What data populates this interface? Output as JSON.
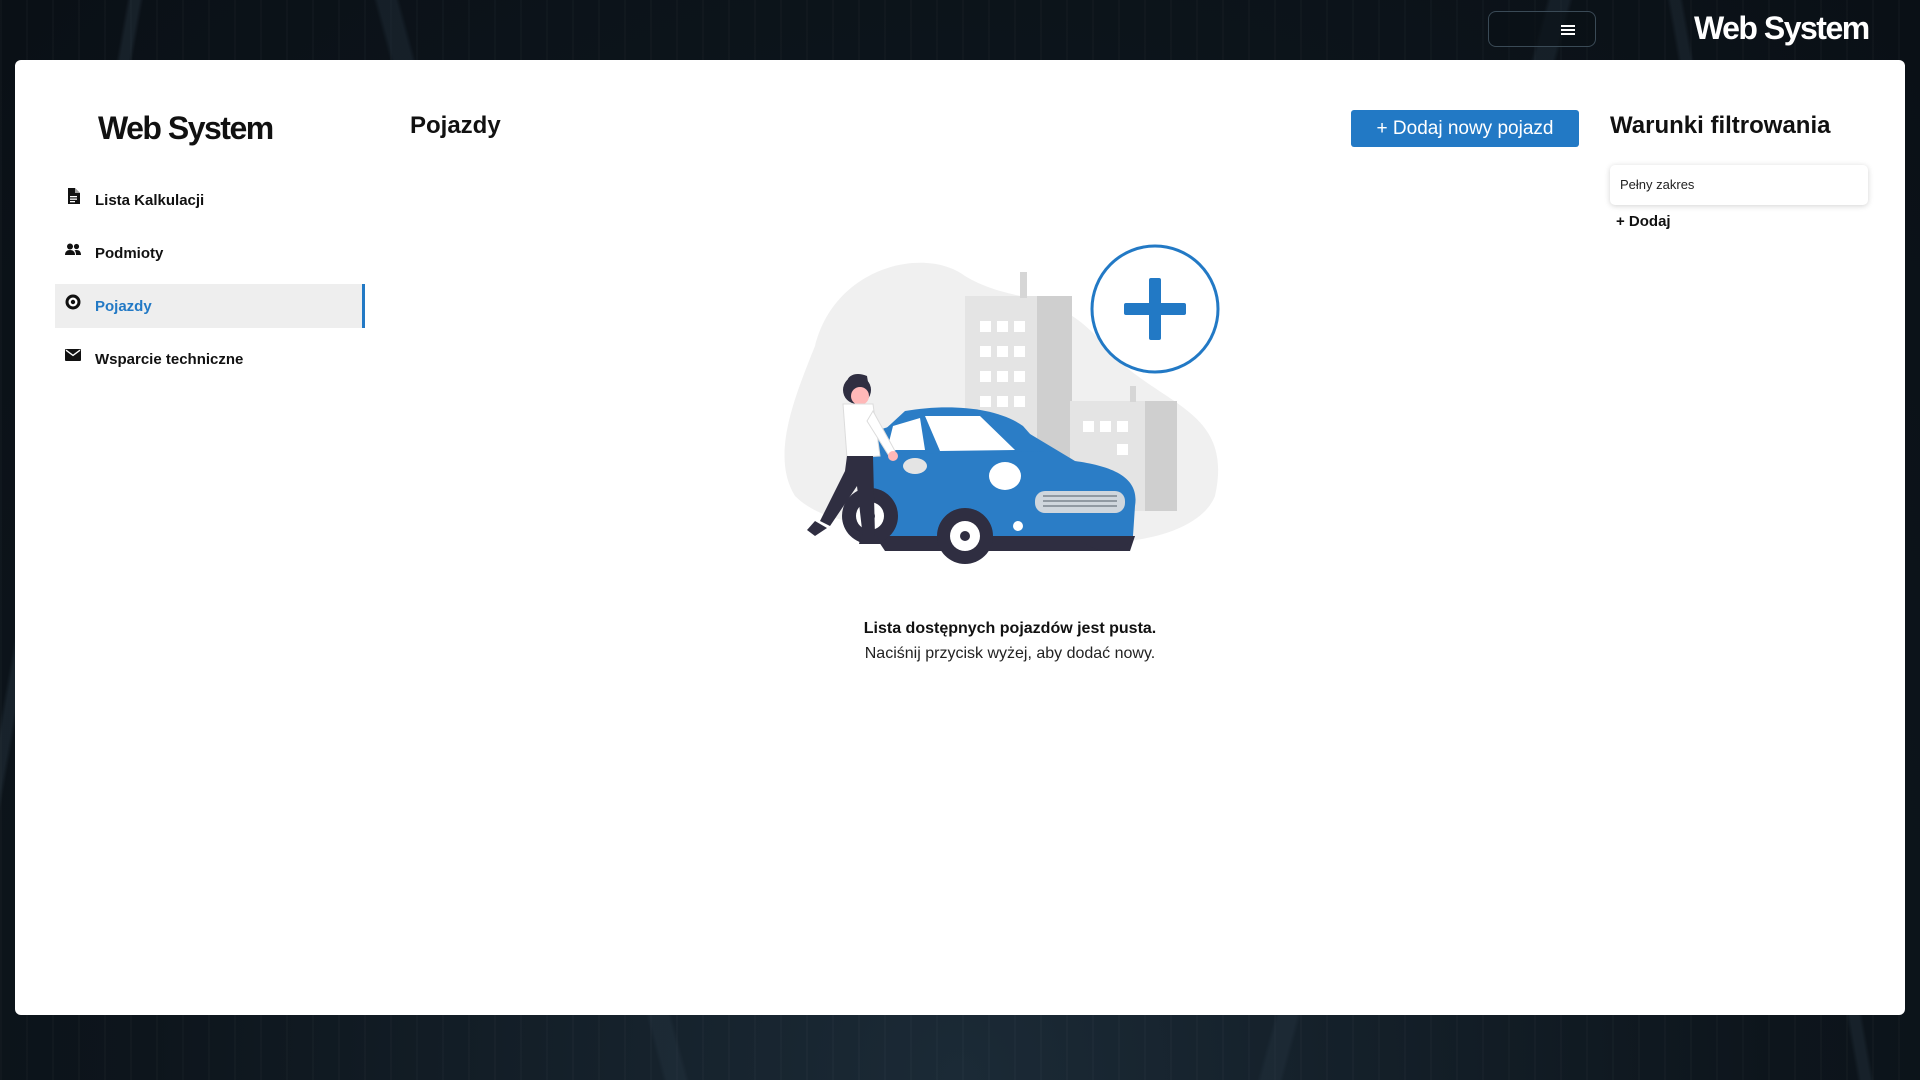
{
  "topbar": {
    "logo": "Web System",
    "menu_icon": "hamburger-icon"
  },
  "sidebar": {
    "logo": "Web System",
    "items": [
      {
        "label": "Lista Kalkulacji",
        "icon": "document-icon",
        "active": false
      },
      {
        "label": "Podmioty",
        "icon": "users-icon",
        "active": false
      },
      {
        "label": "Pojazdy",
        "icon": "vehicle-icon",
        "active": true
      },
      {
        "label": "Wsparcie techniczne",
        "icon": "envelope-icon",
        "active": false
      }
    ]
  },
  "main": {
    "title": "Pojazdy",
    "add_button_label": "+ Dodaj nowy pojazd",
    "empty_title": "Lista dostępnych pojazdów jest pusta.",
    "empty_subtitle": "Naciśnij przycisk wyżej, aby dodać nowy."
  },
  "filters": {
    "title": "Warunki filtrowania",
    "chip_label": "Pełny zakres",
    "add_label": "+ Dodaj"
  },
  "colors": {
    "accent": "#2279c5",
    "background": "#0f1820",
    "panel": "#ffffff"
  }
}
